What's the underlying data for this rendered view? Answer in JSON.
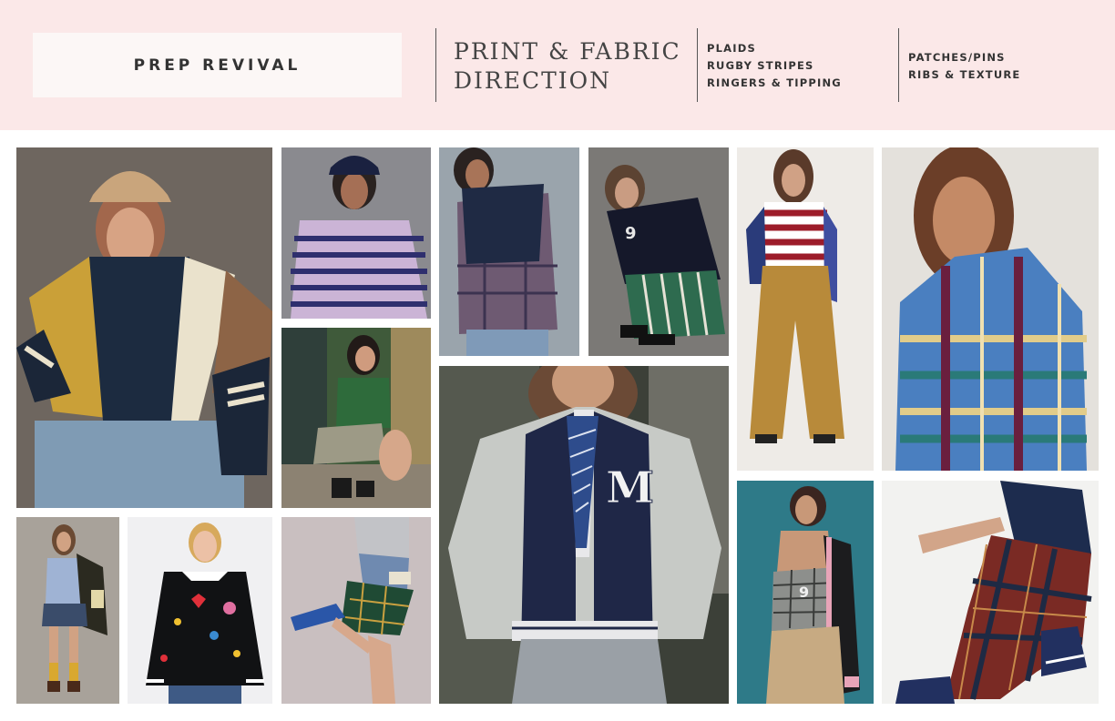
{
  "header": {
    "title": "PREP REVIVAL",
    "heading_line1": "PRINT & FABRIC",
    "heading_line2": "DIRECTION",
    "list_a": [
      "PLAIDS",
      "RUGBY STRIPES",
      "RINGERS & TIPPING"
    ],
    "list_b": [
      "PATCHES/PINS",
      "RIBS & TEXTURE"
    ]
  },
  "colors": {
    "header_bg": "#fbe8e8",
    "title_box_bg": "#fcf7f6",
    "text": "#333333"
  },
  "photos": [
    {
      "name": "photo-colorblock-cable-sweater",
      "subject": "woman in beige cap wearing colorblock cable knit sweater and jeans"
    },
    {
      "name": "photo-striped-sweater-cap",
      "subject": "woman in navy cap wearing lavender and navy striped sweater"
    },
    {
      "name": "photo-green-top-plaid-skirt",
      "subject": "woman crouching in green top and plaid skirt"
    },
    {
      "name": "photo-knit-vest-plaid-shirt",
      "subject": "woman in navy cable knit vest over plaid shirt"
    },
    {
      "name": "photo-navy-sweater-striped-skirt",
      "subject": "woman crouching in navy sweater and green striped skirt"
    },
    {
      "name": "photo-ringer-stripe-tee-wide-pants",
      "subject": "woman in red striped long sleeve top and mustard wide leg pants"
    },
    {
      "name": "photo-plaid-shirt-jacket",
      "subject": "woman in blue plaid shirt jacket"
    },
    {
      "name": "photo-varsity-jacket-tie",
      "subject": "woman in navy and grey varsity jacket with M patch and striped tie"
    },
    {
      "name": "photo-plaid-shorts-varsity",
      "subject": "woman in plaid shorts holding varsity jacket"
    },
    {
      "name": "photo-patch-sweater",
      "subject": "woman in black sweater with embroidered patches"
    },
    {
      "name": "photo-plaid-skirt-sneakers",
      "subject": "woman in green plaid mini skirt and blue sneakers"
    },
    {
      "name": "photo-plaid-corset-top",
      "subject": "woman in plaid corset top with numbered patch"
    },
    {
      "name": "photo-plaid-pants-sneakers",
      "subject": "woman in red plaid pants and navy sneakers"
    }
  ]
}
